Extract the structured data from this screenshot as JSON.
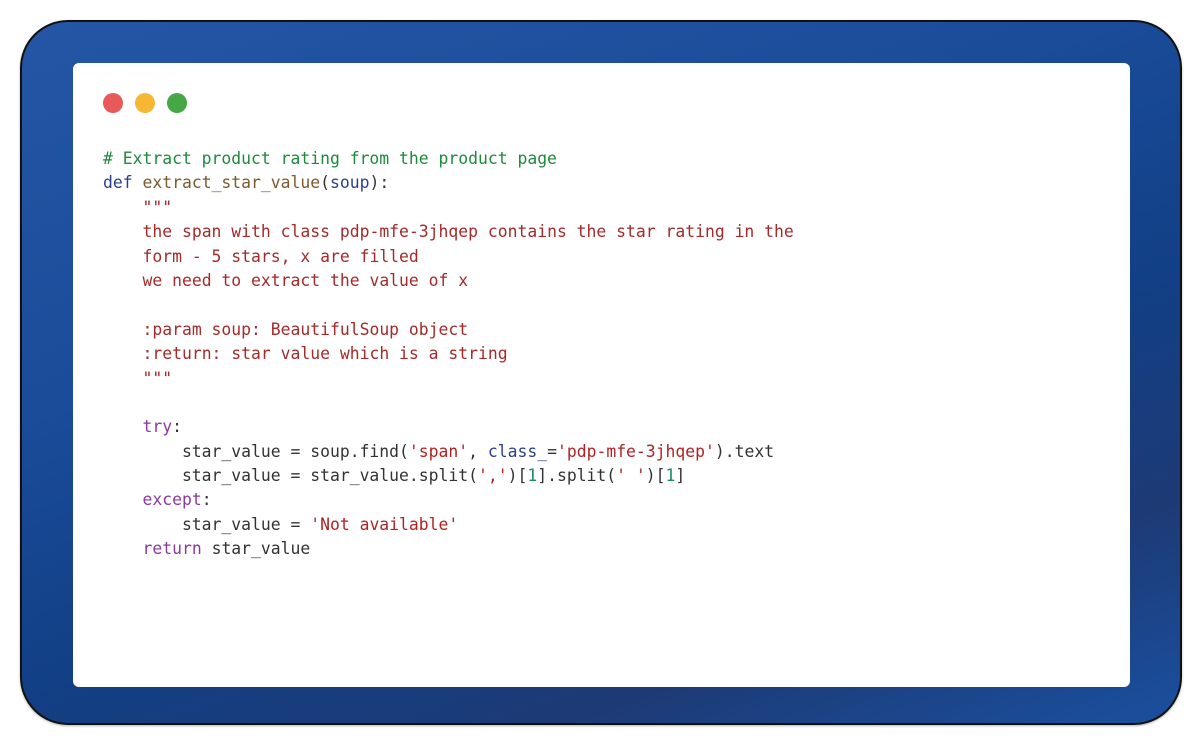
{
  "window": {
    "controls": [
      {
        "name": "close",
        "color": "#e8595a"
      },
      {
        "name": "minimize",
        "color": "#f7b733"
      },
      {
        "name": "maximize",
        "color": "#45a845"
      }
    ]
  },
  "code": {
    "language": "python",
    "lines": [
      [
        {
          "t": "comment",
          "v": "# Extract product rating from the product page"
        }
      ],
      [
        {
          "t": "keyword",
          "v": "def"
        },
        {
          "t": "plain",
          "v": " "
        },
        {
          "t": "func",
          "v": "extract_star_value"
        },
        {
          "t": "plain",
          "v": "("
        },
        {
          "t": "param",
          "v": "soup"
        },
        {
          "t": "plain",
          "v": "):"
        }
      ],
      [
        {
          "t": "plain",
          "v": "    "
        },
        {
          "t": "doc",
          "v": "\"\"\""
        }
      ],
      [
        {
          "t": "plain",
          "v": "    "
        },
        {
          "t": "doc",
          "v": "the span with class pdp-mfe-3jhqep contains the star rating in the"
        }
      ],
      [
        {
          "t": "plain",
          "v": "    "
        },
        {
          "t": "doc",
          "v": "form - 5 stars, x are filled"
        }
      ],
      [
        {
          "t": "plain",
          "v": "    "
        },
        {
          "t": "doc",
          "v": "we need to extract the value of x"
        }
      ],
      [],
      [
        {
          "t": "plain",
          "v": "    "
        },
        {
          "t": "doc",
          "v": ":param soup: BeautifulSoup object"
        }
      ],
      [
        {
          "t": "plain",
          "v": "    "
        },
        {
          "t": "doc",
          "v": ":return: star value which is a string"
        }
      ],
      [
        {
          "t": "plain",
          "v": "    "
        },
        {
          "t": "doc",
          "v": "\"\"\""
        }
      ],
      [],
      [
        {
          "t": "plain",
          "v": "    "
        },
        {
          "t": "control",
          "v": "try"
        },
        {
          "t": "plain",
          "v": ":"
        }
      ],
      [
        {
          "t": "plain",
          "v": "        star_value = soup.find("
        },
        {
          "t": "string",
          "v": "'span'"
        },
        {
          "t": "plain",
          "v": ", "
        },
        {
          "t": "param",
          "v": "class_"
        },
        {
          "t": "plain",
          "v": "="
        },
        {
          "t": "string",
          "v": "'pdp-mfe-3jhqep'"
        },
        {
          "t": "plain",
          "v": ").text"
        }
      ],
      [
        {
          "t": "plain",
          "v": "        star_value = star_value.split("
        },
        {
          "t": "string",
          "v": "','"
        },
        {
          "t": "plain",
          "v": ")["
        },
        {
          "t": "number",
          "v": "1"
        },
        {
          "t": "plain",
          "v": "].split("
        },
        {
          "t": "string",
          "v": "' '"
        },
        {
          "t": "plain",
          "v": ")["
        },
        {
          "t": "number",
          "v": "1"
        },
        {
          "t": "plain",
          "v": "]"
        }
      ],
      [
        {
          "t": "plain",
          "v": "    "
        },
        {
          "t": "control",
          "v": "except"
        },
        {
          "t": "plain",
          "v": ":"
        }
      ],
      [
        {
          "t": "plain",
          "v": "        star_value = "
        },
        {
          "t": "string",
          "v": "'Not available'"
        }
      ],
      [
        {
          "t": "plain",
          "v": "    "
        },
        {
          "t": "control",
          "v": "return"
        },
        {
          "t": "plain",
          "v": " star_value"
        }
      ]
    ]
  }
}
